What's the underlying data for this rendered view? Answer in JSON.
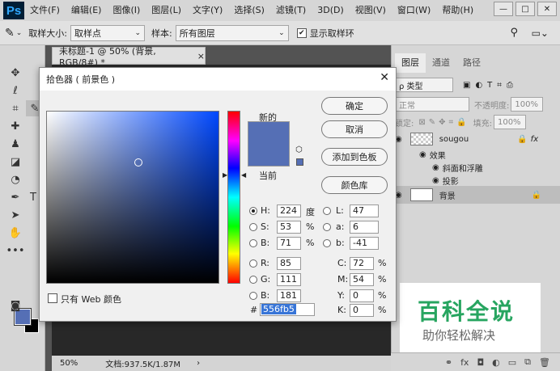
{
  "app": {
    "logo": "Ps"
  },
  "menu": [
    "文件(F)",
    "编辑(E)",
    "图像(I)",
    "图层(L)",
    "文字(Y)",
    "选择(S)",
    "滤镜(T)",
    "3D(D)",
    "视图(V)",
    "窗口(W)",
    "帮助(H)"
  ],
  "window_buttons": [
    "—",
    "□",
    "✕"
  ],
  "options": {
    "sample_size_label": "取样大小:",
    "sample_size_value": "取样点",
    "sample_label": "样本:",
    "sample_value": "所有图层",
    "show_ring_label": "显示取样环"
  },
  "document": {
    "tab_title": "未标题-1 @ 50% (背景, RGB/8#) *",
    "close": "×",
    "zoom": "50%",
    "doc_info": "文档:937.5K/1.87M"
  },
  "layers_panel": {
    "tabs": [
      "图层",
      "通道",
      "路径"
    ],
    "filter_kind": "ρ 类型",
    "blend_mode": "正常",
    "opacity_label": "不透明度:",
    "opacity_value": "100%",
    "lock_label": "锁定:",
    "fill_label": "填充:",
    "fill_value": "100%",
    "layers": [
      {
        "name": "sougou",
        "fx": "fx"
      },
      {
        "name": "效果"
      },
      {
        "name": "斜面和浮雕"
      },
      {
        "name": "投影"
      },
      {
        "name": "背景"
      }
    ]
  },
  "color_picker": {
    "title": "拾色器 ( 前景色 )",
    "new_label": "新的",
    "current_label": "当前",
    "buttons": {
      "ok": "确定",
      "cancel": "取消",
      "add_swatch": "添加到色板",
      "libraries": "颜色库"
    },
    "web_only_label": "只有 Web 颜色",
    "fields": {
      "H": {
        "label": "H:",
        "value": "224",
        "unit": "度"
      },
      "S": {
        "label": "S:",
        "value": "53",
        "unit": "%"
      },
      "B": {
        "label": "B:",
        "value": "71",
        "unit": "%"
      },
      "R": {
        "label": "R:",
        "value": "85"
      },
      "G": {
        "label": "G:",
        "value": "111"
      },
      "Bl": {
        "label": "B:",
        "value": "181"
      },
      "L": {
        "label": "L:",
        "value": "47"
      },
      "a": {
        "label": "a:",
        "value": "6"
      },
      "b": {
        "label": "b:",
        "value": "-41"
      },
      "C": {
        "label": "C:",
        "value": "72",
        "unit": "%"
      },
      "M": {
        "label": "M:",
        "value": "54",
        "unit": "%"
      },
      "Y": {
        "label": "Y:",
        "value": "0",
        "unit": "%"
      },
      "K": {
        "label": "K:",
        "value": "0",
        "unit": "%"
      }
    },
    "hex_label": "#",
    "hex_value": "556fb5",
    "selected_color": "#556fb5"
  },
  "watermark": {
    "title": "百科全说",
    "subtitle": "助你轻松解决"
  }
}
